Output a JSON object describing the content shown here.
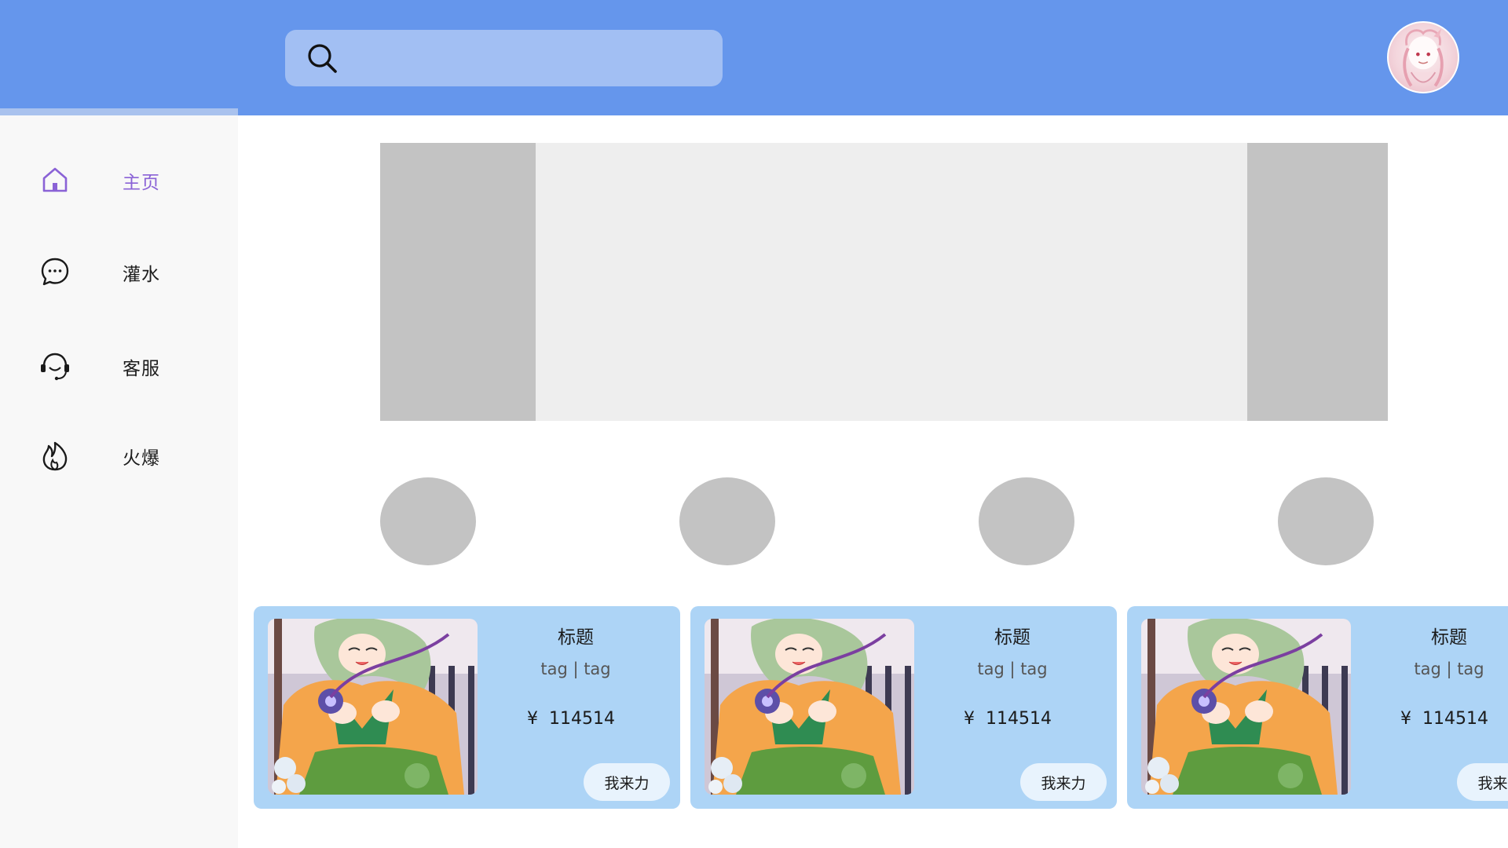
{
  "header": {
    "search": {
      "value": "",
      "placeholder": ""
    },
    "avatar_icon": "user-avatar-anime"
  },
  "sidebar": {
    "items": [
      {
        "label": "主页",
        "icon": "home-icon",
        "active": true
      },
      {
        "label": "灌水",
        "icon": "chat-bubble-icon",
        "active": false
      },
      {
        "label": "客服",
        "icon": "headset-icon",
        "active": false
      },
      {
        "label": "火爆",
        "icon": "flame-icon",
        "active": false
      }
    ]
  },
  "banner": {
    "slides": 3
  },
  "categories": [
    {
      "icon": "placeholder-circle"
    },
    {
      "icon": "placeholder-circle"
    },
    {
      "icon": "placeholder-circle"
    },
    {
      "icon": "placeholder-circle"
    }
  ],
  "products": [
    {
      "title": "标题",
      "tags": "tag | tag",
      "currency": "¥",
      "price": "114514",
      "button": "我来力"
    },
    {
      "title": "标题",
      "tags": "tag | tag",
      "currency": "¥",
      "price": "114514",
      "button": "我来力"
    },
    {
      "title": "标题",
      "tags": "tag | tag",
      "currency": "¥",
      "price": "114514",
      "button": "我来力"
    }
  ],
  "colors": {
    "header": "#6596EC",
    "search_box": "#A2BFF3",
    "sidebar": "#F8F8F8",
    "active_nav": "#8A62D6",
    "card": "#ADD4F6",
    "placeholder": "#C3C3C3"
  }
}
